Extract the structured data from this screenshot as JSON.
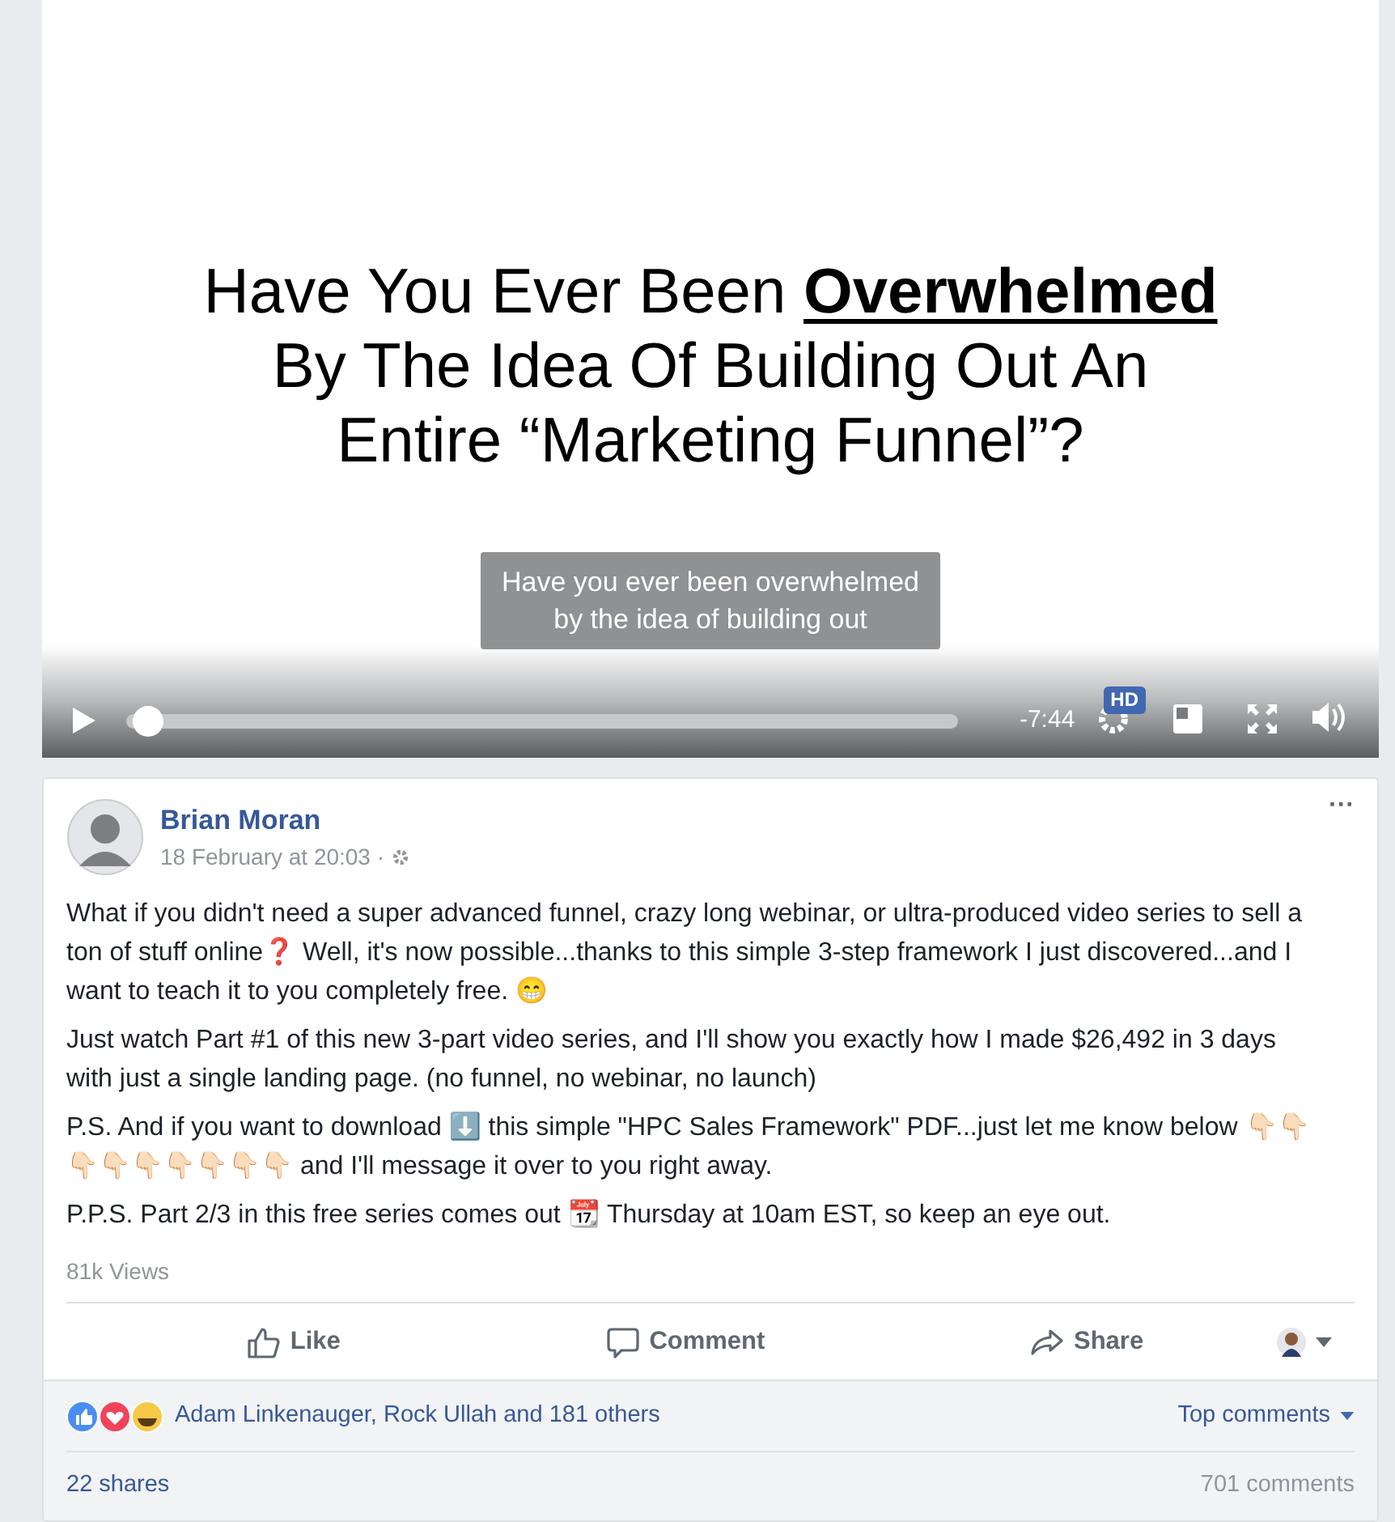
{
  "video": {
    "slide_lines": [
      "Have You Ever Been **Overwhelmed**",
      "By The Idea Of Building Out An",
      "Entire “Marketing Funnel”?"
    ],
    "caption": [
      "Have you ever been overwhelmed",
      "by the idea of building out"
    ],
    "progress": {
      "level": 0.01
    },
    "time": "-7:44",
    "quality_badge": "HD"
  },
  "post": {
    "author": "Brian Moran",
    "timestamp": "18 February at 20:03 ·",
    "more": "···",
    "paragraphs": [
      "What if you didn't need a super advanced funnel, crazy long webinar, or ultra-produced video series to sell a ton of stuff online❓ Well, it's now possible...thanks to this simple 3-step framework I just discovered...and I want to teach it to you completely free. 😁",
      "Just watch Part #1 of this new 3-part video series, and I'll show you exactly how I made $26,492 in 3 days with just a single landing page. (no funnel, no webinar, no launch)",
      "P.S. And if you want to download ⬇️ this simple \"HPC Sales Framework\" PDF...just let me know below 👇🏻👇🏻👇🏻👇🏻👇🏻👇🏻👇🏻👇🏻👇🏻 and I'll message it over to you right away.",
      "P.P.S. Part 2/3 in this free series comes out 📆 Thursday at 10am EST, so keep an eye out."
    ],
    "views": "81k Views",
    "actions": [
      {
        "kind": "like",
        "label": "Like"
      },
      {
        "kind": "comment",
        "label": "Comment"
      },
      {
        "kind": "share",
        "label": "Share"
      }
    ],
    "reactions": {
      "text": "Adam Linkenauger, Rock Ullah and 181 others",
      "sort": "Top comments"
    },
    "shares": "22 shares",
    "comments": "701 comments"
  }
}
